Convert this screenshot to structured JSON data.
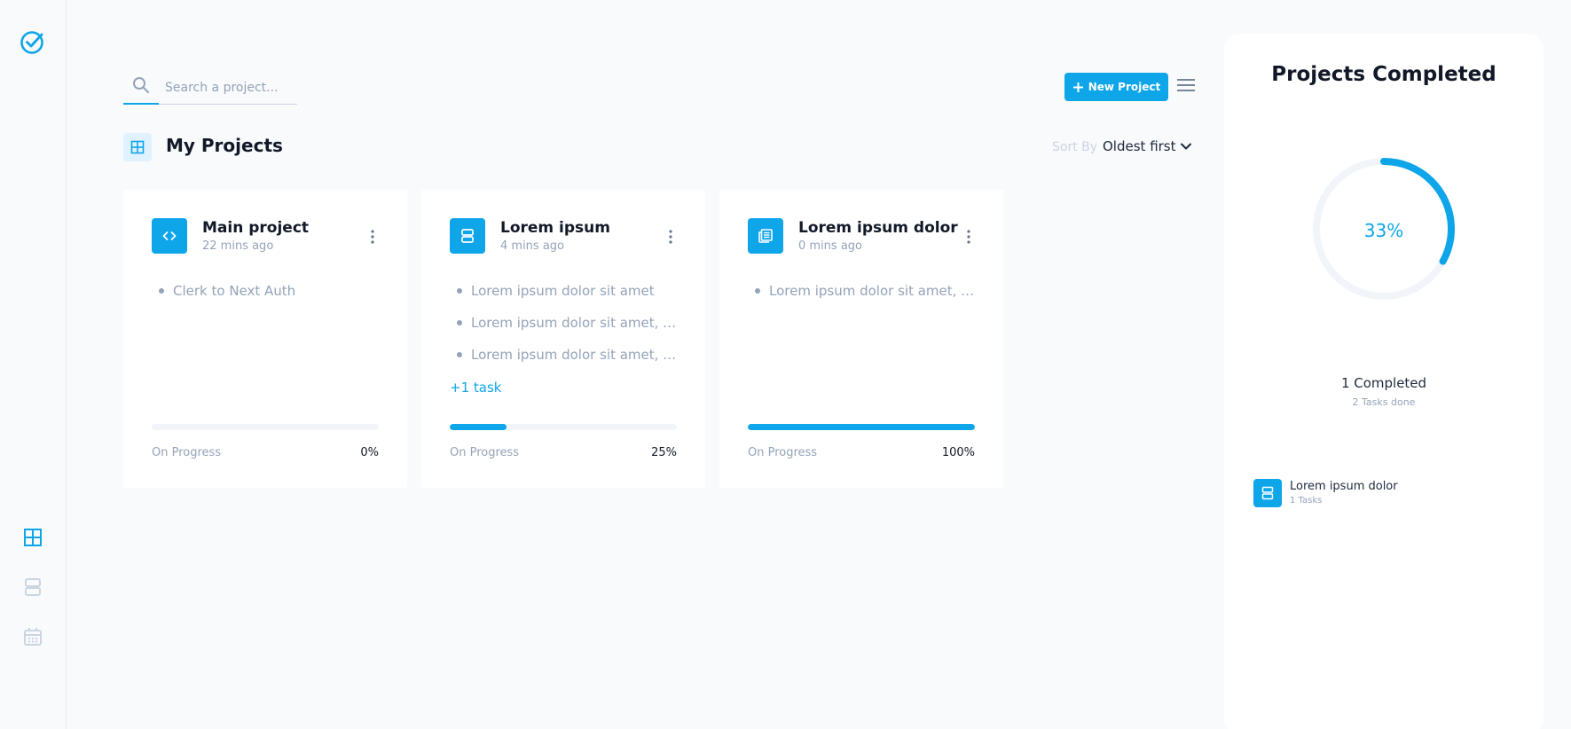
{
  "search": {
    "placeholder": "Search a project..."
  },
  "toolbar": {
    "new_project_label": "New Project"
  },
  "header": {
    "title": "My Projects",
    "sort_label": "Sort By",
    "sort_value": "Oldest first"
  },
  "sidebar": {
    "items": [
      "logo-check-icon",
      "grid-icon",
      "rows-icon",
      "calendar-icon"
    ],
    "active": "grid-icon"
  },
  "projects": [
    {
      "title": "Main project",
      "time": "22 mins ago",
      "icon": "code-icon",
      "tasks": [
        "Clerk to Next Auth"
      ],
      "more": "",
      "progress_label": "On Progress",
      "progress": 0,
      "progress_text": "0%"
    },
    {
      "title": "Lorem ipsum",
      "time": "4 mins ago",
      "icon": "rows-icon",
      "tasks": [
        "Lorem ipsum dolor sit amet",
        "Lorem ipsum dolor sit amet, co...",
        "Lorem ipsum dolor sit amet, co..."
      ],
      "more": "+1 task",
      "progress_label": "On Progress",
      "progress": 25,
      "progress_text": "25%"
    },
    {
      "title": "Lorem ipsum dolor",
      "time": "0 mins ago",
      "icon": "newspaper-icon",
      "tasks": [
        "Lorem ipsum dolor sit amet, con"
      ],
      "more": "",
      "progress_label": "On Progress",
      "progress": 100,
      "progress_text": "100%"
    }
  ],
  "panel": {
    "title": "Projects Completed",
    "percent": 33,
    "percent_text": "33%",
    "completed": "1 Completed",
    "tasks_done": "2 Tasks done",
    "items": [
      {
        "title": "Lorem ipsum dolor",
        "sub": "1 Tasks",
        "icon": "rows-icon"
      }
    ]
  },
  "colors": {
    "accent": "#0ea5e9",
    "muted": "#94a3b8",
    "track": "#f1f5f9"
  }
}
